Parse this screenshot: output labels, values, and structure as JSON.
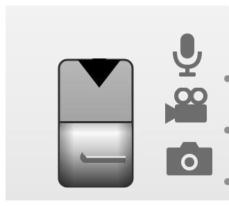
{
  "app": {
    "title": ""
  },
  "capture_switch": {
    "selected_mode": "camera",
    "direction_hint": "down"
  },
  "modes": [
    {
      "id": "audio",
      "icon": "microphone-icon"
    },
    {
      "id": "video",
      "icon": "video-camera-icon"
    },
    {
      "id": "photo",
      "icon": "camera-icon"
    }
  ],
  "colors": {
    "background": "#ececec",
    "icon": "#6d6d6d",
    "arrow": "#000000",
    "dot": "#8e8e8e"
  }
}
